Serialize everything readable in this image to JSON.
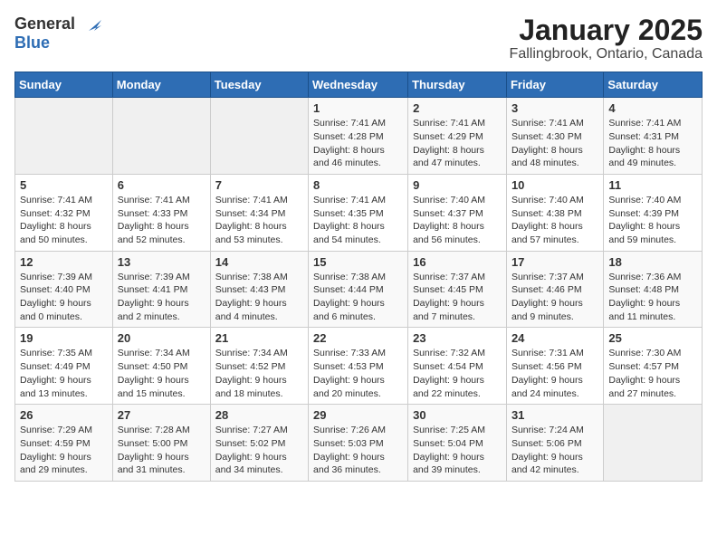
{
  "header": {
    "logo_general": "General",
    "logo_blue": "Blue",
    "title": "January 2025",
    "subtitle": "Fallingbrook, Ontario, Canada"
  },
  "calendar": {
    "days_of_week": [
      "Sunday",
      "Monday",
      "Tuesday",
      "Wednesday",
      "Thursday",
      "Friday",
      "Saturday"
    ],
    "weeks": [
      [
        {
          "day": "",
          "info": ""
        },
        {
          "day": "",
          "info": ""
        },
        {
          "day": "",
          "info": ""
        },
        {
          "day": "1",
          "info": "Sunrise: 7:41 AM\nSunset: 4:28 PM\nDaylight: 8 hours and 46 minutes."
        },
        {
          "day": "2",
          "info": "Sunrise: 7:41 AM\nSunset: 4:29 PM\nDaylight: 8 hours and 47 minutes."
        },
        {
          "day": "3",
          "info": "Sunrise: 7:41 AM\nSunset: 4:30 PM\nDaylight: 8 hours and 48 minutes."
        },
        {
          "day": "4",
          "info": "Sunrise: 7:41 AM\nSunset: 4:31 PM\nDaylight: 8 hours and 49 minutes."
        }
      ],
      [
        {
          "day": "5",
          "info": "Sunrise: 7:41 AM\nSunset: 4:32 PM\nDaylight: 8 hours and 50 minutes."
        },
        {
          "day": "6",
          "info": "Sunrise: 7:41 AM\nSunset: 4:33 PM\nDaylight: 8 hours and 52 minutes."
        },
        {
          "day": "7",
          "info": "Sunrise: 7:41 AM\nSunset: 4:34 PM\nDaylight: 8 hours and 53 minutes."
        },
        {
          "day": "8",
          "info": "Sunrise: 7:41 AM\nSunset: 4:35 PM\nDaylight: 8 hours and 54 minutes."
        },
        {
          "day": "9",
          "info": "Sunrise: 7:40 AM\nSunset: 4:37 PM\nDaylight: 8 hours and 56 minutes."
        },
        {
          "day": "10",
          "info": "Sunrise: 7:40 AM\nSunset: 4:38 PM\nDaylight: 8 hours and 57 minutes."
        },
        {
          "day": "11",
          "info": "Sunrise: 7:40 AM\nSunset: 4:39 PM\nDaylight: 8 hours and 59 minutes."
        }
      ],
      [
        {
          "day": "12",
          "info": "Sunrise: 7:39 AM\nSunset: 4:40 PM\nDaylight: 9 hours and 0 minutes."
        },
        {
          "day": "13",
          "info": "Sunrise: 7:39 AM\nSunset: 4:41 PM\nDaylight: 9 hours and 2 minutes."
        },
        {
          "day": "14",
          "info": "Sunrise: 7:38 AM\nSunset: 4:43 PM\nDaylight: 9 hours and 4 minutes."
        },
        {
          "day": "15",
          "info": "Sunrise: 7:38 AM\nSunset: 4:44 PM\nDaylight: 9 hours and 6 minutes."
        },
        {
          "day": "16",
          "info": "Sunrise: 7:37 AM\nSunset: 4:45 PM\nDaylight: 9 hours and 7 minutes."
        },
        {
          "day": "17",
          "info": "Sunrise: 7:37 AM\nSunset: 4:46 PM\nDaylight: 9 hours and 9 minutes."
        },
        {
          "day": "18",
          "info": "Sunrise: 7:36 AM\nSunset: 4:48 PM\nDaylight: 9 hours and 11 minutes."
        }
      ],
      [
        {
          "day": "19",
          "info": "Sunrise: 7:35 AM\nSunset: 4:49 PM\nDaylight: 9 hours and 13 minutes."
        },
        {
          "day": "20",
          "info": "Sunrise: 7:34 AM\nSunset: 4:50 PM\nDaylight: 9 hours and 15 minutes."
        },
        {
          "day": "21",
          "info": "Sunrise: 7:34 AM\nSunset: 4:52 PM\nDaylight: 9 hours and 18 minutes."
        },
        {
          "day": "22",
          "info": "Sunrise: 7:33 AM\nSunset: 4:53 PM\nDaylight: 9 hours and 20 minutes."
        },
        {
          "day": "23",
          "info": "Sunrise: 7:32 AM\nSunset: 4:54 PM\nDaylight: 9 hours and 22 minutes."
        },
        {
          "day": "24",
          "info": "Sunrise: 7:31 AM\nSunset: 4:56 PM\nDaylight: 9 hours and 24 minutes."
        },
        {
          "day": "25",
          "info": "Sunrise: 7:30 AM\nSunset: 4:57 PM\nDaylight: 9 hours and 27 minutes."
        }
      ],
      [
        {
          "day": "26",
          "info": "Sunrise: 7:29 AM\nSunset: 4:59 PM\nDaylight: 9 hours and 29 minutes."
        },
        {
          "day": "27",
          "info": "Sunrise: 7:28 AM\nSunset: 5:00 PM\nDaylight: 9 hours and 31 minutes."
        },
        {
          "day": "28",
          "info": "Sunrise: 7:27 AM\nSunset: 5:02 PM\nDaylight: 9 hours and 34 minutes."
        },
        {
          "day": "29",
          "info": "Sunrise: 7:26 AM\nSunset: 5:03 PM\nDaylight: 9 hours and 36 minutes."
        },
        {
          "day": "30",
          "info": "Sunrise: 7:25 AM\nSunset: 5:04 PM\nDaylight: 9 hours and 39 minutes."
        },
        {
          "day": "31",
          "info": "Sunrise: 7:24 AM\nSunset: 5:06 PM\nDaylight: 9 hours and 42 minutes."
        },
        {
          "day": "",
          "info": ""
        }
      ]
    ]
  }
}
